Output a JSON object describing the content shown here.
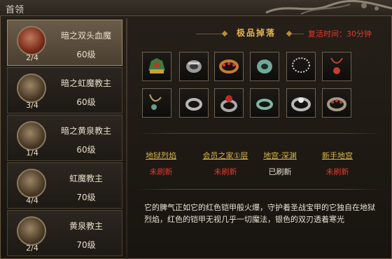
{
  "window": {
    "title": "首领"
  },
  "bosses": [
    {
      "name": "暗之双头血魔",
      "level": "60级",
      "count": "2/4",
      "avatar": "red"
    },
    {
      "name": "暗之虹魔教主",
      "level": "60级",
      "count": "3/4",
      "avatar": "gold"
    },
    {
      "name": "暗之黄泉教主",
      "level": "60级",
      "count": "1/4",
      "avatar": "gold"
    },
    {
      "name": "虹魔教主",
      "level": "70级",
      "count": "4/4",
      "avatar": "gold"
    },
    {
      "name": "黄泉教主",
      "level": "70级",
      "count": "2/4",
      "avatar": "gold"
    }
  ],
  "drops": {
    "title": "极品掉落",
    "respawn": "复活时间：30分钟",
    "items": [
      "helmet-icon",
      "bracelet-icon",
      "ring-icon",
      "jade-bracelet-icon",
      "necklace-icon",
      "pendant-icon",
      "pendant-icon",
      "ring-icon",
      "ring-icon",
      "ring-icon",
      "ring-icon",
      "ring-icon"
    ]
  },
  "maps": [
    {
      "name": "地狱烈焰",
      "status": "未刷新",
      "color": "#e03a2b"
    },
    {
      "name": "会员之家①层",
      "status": "未刷新",
      "color": "#e03a2b"
    },
    {
      "name": "地宫·深渊",
      "status": "已刷新",
      "color": "#e9e2d3"
    },
    {
      "name": "新手地宫",
      "status": "未刷新",
      "color": "#e03a2b"
    }
  ],
  "description": "它的脾气正如它的红色铠甲般火爆，守护着圣战宝甲的它独自在地狱烈焰，红色的铠甲无视几乎一切魔法，银色的双刃透着寒光"
}
